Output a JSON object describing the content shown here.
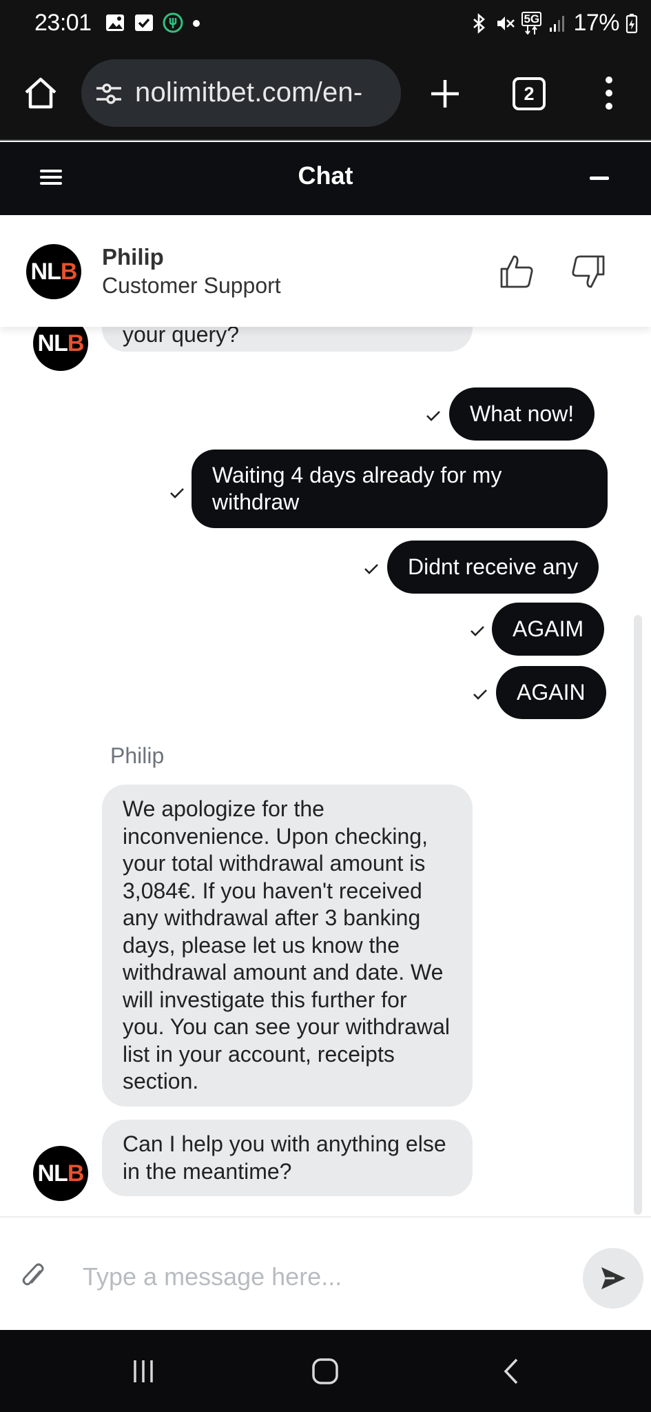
{
  "status_bar": {
    "time": "23:01",
    "battery": "17%",
    "network": "5G",
    "icons": [
      "gallery-icon",
      "checkbox-icon",
      "fork-knife-icon",
      "dot-icon",
      "bluetooth-icon",
      "mute-icon",
      "signal-icon",
      "battery-icon"
    ]
  },
  "browser": {
    "url": "nolimitbet.com/en-",
    "tab_count": "2",
    "icons": [
      "home-icon",
      "tune-icon",
      "plus-icon",
      "tabs-icon",
      "overflow-menu-icon"
    ]
  },
  "chat_header": {
    "title": "Chat",
    "icons": [
      "hamburger-menu-icon",
      "minimize-icon"
    ]
  },
  "agent": {
    "avatar_left": "NL",
    "avatar_right": "B",
    "name": "Philip",
    "role": "Customer Support",
    "icons": [
      "thumbs-up-icon",
      "thumbs-down-icon"
    ]
  },
  "messages": {
    "agent_partial": "your query?",
    "user": [
      "What now!",
      "Waiting 4 days already for my withdraw",
      "Didnt receive any",
      "AGAIM",
      "AGAIN"
    ],
    "agent_name_label": "Philip",
    "agent_reply_1": "We apologize for the inconvenience. Upon checking, your total withdrawal amount is 3,084€. If you haven't received any withdrawal after 3 banking days, please let us know the withdrawal amount and date. We will investigate this further for you. You can see your withdrawal list in your account, receipts section.",
    "agent_reply_2": "Can I help you with anything else in the meantime?"
  },
  "composer": {
    "placeholder": "Type a message here...",
    "icons": [
      "paperclip-icon",
      "send-icon"
    ]
  },
  "colors": {
    "user_bubble": "#0d0e12",
    "agent_bubble": "#e9eaec",
    "logo_accent": "#e8512b"
  }
}
